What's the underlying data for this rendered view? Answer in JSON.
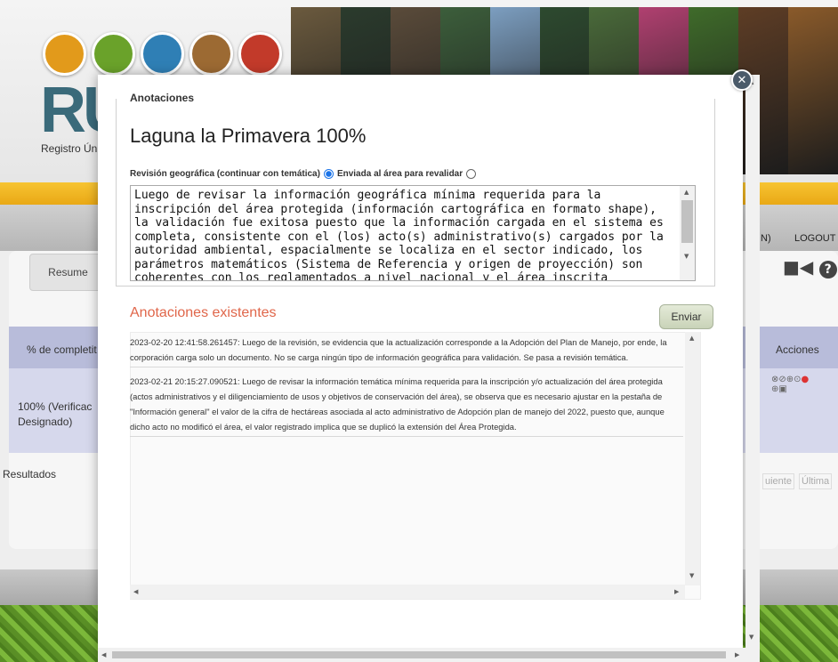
{
  "background": {
    "registro_text": "Registro Ún",
    "logo_letters": "RU",
    "nav_right_partial": "N)",
    "logout": "LOGOUT",
    "tab_resumen": "Resume",
    "col_completitud": "% de completit",
    "col_acciones": "Acciones",
    "row_value": "100% (Verificac",
    "row_value_2": "Designado)",
    "resultados": "Resultados",
    "pager_next": "uiente",
    "pager_last": "Última",
    "photo_colors": [
      "#6b5a3e",
      "#2b3b2d",
      "#5a4b3a",
      "#3c5e3b",
      "#7c9ec0",
      "#2d4a2f",
      "#4a6a3a",
      "#b04070",
      "#3f6b2a",
      "#5e3d25",
      "#8a5a2a"
    ],
    "logo_colors": [
      "#e29a1b",
      "#6aa22a",
      "#2f7fb5",
      "#9c6a33",
      "#c23a2a"
    ]
  },
  "modal": {
    "legend": "Anotaciones",
    "title": "Laguna la Primavera 100%",
    "radio1_label": "Revisión geográfica (continuar con temática)",
    "radio2_label": "Enviada al área para revalidar",
    "textarea": "Luego de revisar la información geográfica mínima requerida para la inscripción del área protegida (información cartográfica en formato shape), la validación fue exitosa puesto que la información cargada en el sistema es completa, consistente con el (los) acto(s) administrativo(s) cargados por la autoridad ambiental, espacialmente se localiza en el sector indicado, los parámetros matemáticos (Sistema de Referencia y origen de proyección) son coherentes con los reglamentados a nivel nacional y el área inscrita concuerda con el área calculada a partir de un",
    "existentes_title": "Anotaciones existentes",
    "enviar": "Enviar",
    "notes": [
      {
        "timestamp": "2023-02-20 12:41:58.261457:",
        "text": " Luego de la revisión, se evidencia que la actualización corresponde a la Adopción del Plan de Manejo, por ende, la corporación carga solo un documento. No se carga ningún tipo de información geográfica para validación. Se pasa a revisión temática."
      },
      {
        "timestamp": "2023-02-21 20:15:27.090521:",
        "text": " Luego de revisar la información temática mínima requerida para la inscripción y/o actualización del área protegida (actos administrativos y el diligenciamiento de usos y objetivos de conservación del área), se observa que es necesario ajustar en la pestaña de \"Información general\" el valor de la cifra de hectáreas asociada al acto administrativo de Adopción plan de manejo del 2022, puesto que, aunque dicho acto no modificó el área, el valor registrado implica que se duplicó la extensión del Área Protegida."
      }
    ]
  }
}
